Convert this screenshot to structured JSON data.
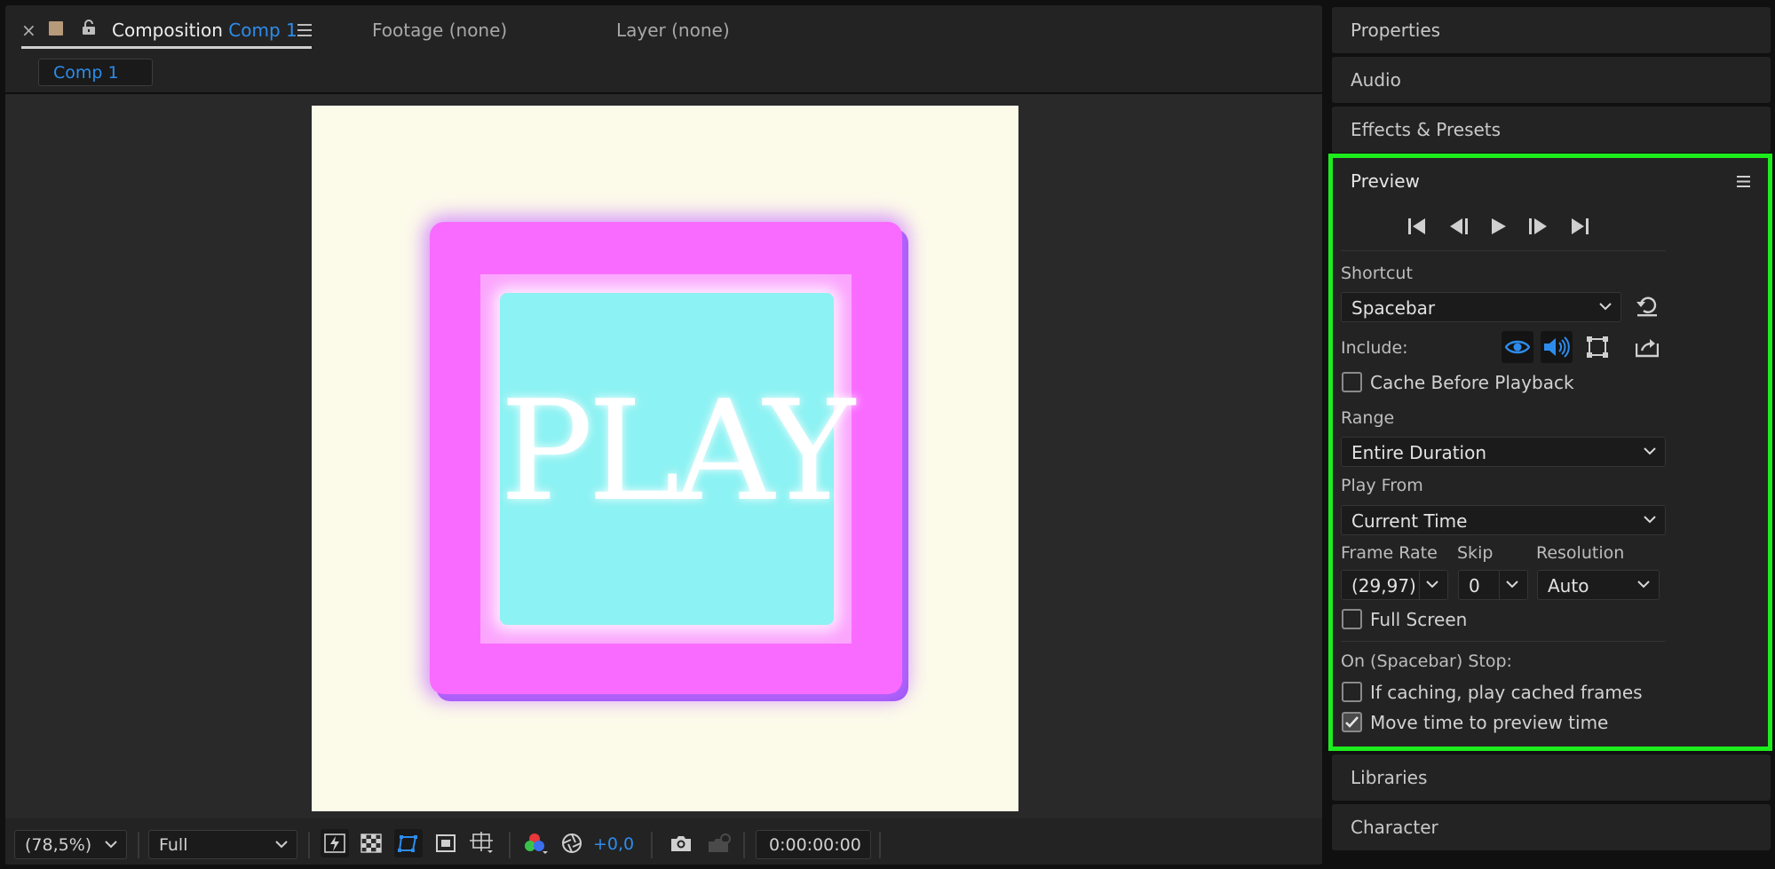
{
  "composition_panel": {
    "close_glyph": "×",
    "title_prefix": "Composition",
    "title_comp": "Comp 1",
    "footage_tab": "Footage (none)",
    "layer_tab": "Layer (none)",
    "comp_chip": "Comp 1",
    "canvas_text": "PLAY",
    "colors": {
      "canvas": "#fcfbea",
      "button_outer": "#f96bff",
      "button_inner": "#8df2f3",
      "accent": "#2d8ceb"
    }
  },
  "toolbar": {
    "zoom": "(78,5%)",
    "resolution": "Full",
    "exposure": "+0,0",
    "timecode": "0:00:00:00",
    "icons": [
      "fast-previews-icon",
      "transparency-grid-icon",
      "mask-path-visibility-icon",
      "region-of-interest-icon",
      "guides-grid-icon",
      "channel-rgb-icon",
      "reset-exposure-icon",
      "snapshot-camera-icon",
      "show-snapshot-icon"
    ]
  },
  "right_dock": {
    "properties": "Properties",
    "audio": "Audio",
    "effects": "Effects & Presets",
    "libraries": "Libraries",
    "character": "Character"
  },
  "preview": {
    "title": "Preview",
    "transport": [
      "first-frame-icon",
      "previous-frame-icon",
      "play-icon",
      "next-frame-icon",
      "last-frame-icon"
    ],
    "shortcut_label": "Shortcut",
    "shortcut_value": "Spacebar",
    "include_label": "Include:",
    "cache_before_playback": {
      "label": "Cache Before Playback",
      "checked": false
    },
    "range_label": "Range",
    "range_value": "Entire Duration",
    "play_from_label": "Play From",
    "play_from_value": "Current Time",
    "frame_rate_label": "Frame Rate",
    "frame_rate_value": "(29,97)",
    "skip_label": "Skip",
    "skip_value": "0",
    "resolution_label": "Resolution",
    "resolution_value": "Auto",
    "full_screen": {
      "label": "Full Screen",
      "checked": false
    },
    "stop_label": "On (Spacebar) Stop:",
    "if_caching": {
      "label": "If caching, play cached frames",
      "checked": false
    },
    "move_time": {
      "label": "Move time to preview time",
      "checked": true
    },
    "highlight_color": "#1dec1d"
  }
}
